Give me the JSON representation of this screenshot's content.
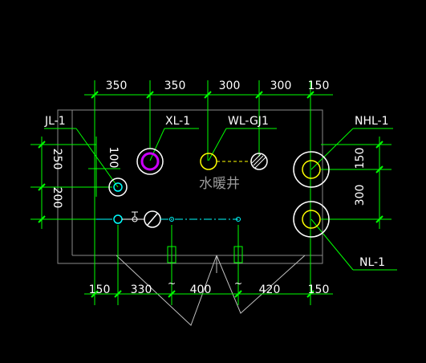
{
  "colors": {
    "background": "#000000",
    "dimension": "#00ff00",
    "wall": "#8a8a8a",
    "pipe": "#ffffff",
    "cyan": "#00ffff",
    "yellow": "#ffff00",
    "magenta": "#cc00ff",
    "room_label": "#9a9a9a"
  },
  "top_dims": [
    "350",
    "350",
    "300",
    "300",
    "150"
  ],
  "bottom_dims": [
    "150",
    "330",
    "400",
    "420",
    "150"
  ],
  "left_dims": [
    "250",
    "200"
  ],
  "inner_dim": "100",
  "right_dims": [
    "150",
    "300"
  ],
  "labels": {
    "jl": "JL-1",
    "xl": "XL-1",
    "wl": "WL-GJ1",
    "nhl": "NHL-1",
    "nl": "NL-1",
    "room": "水暖井"
  }
}
